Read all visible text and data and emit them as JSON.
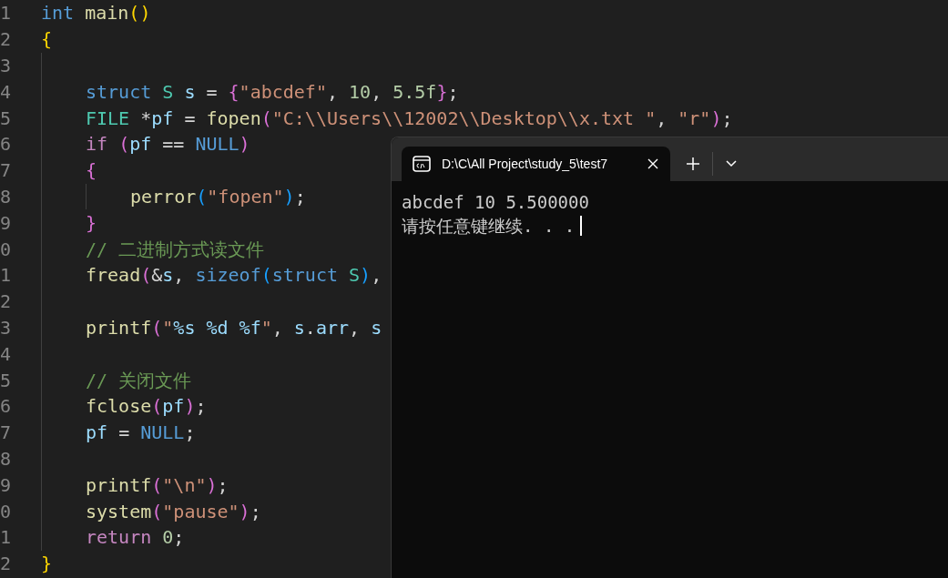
{
  "editor": {
    "lines": [
      {
        "number": "1",
        "tokens": [
          {
            "kind": "keyword",
            "text": "int "
          },
          {
            "kind": "function",
            "text": "main"
          },
          {
            "kind": "brace1",
            "text": "()"
          }
        ]
      },
      {
        "number": "2",
        "tokens": [
          {
            "kind": "brace1",
            "text": "{"
          }
        ],
        "children": [
          {
            "number": "3"
          },
          {
            "number": "4",
            "tokens": [
              {
                "kind": "keyword",
                "text": "struct "
              },
              {
                "kind": "type",
                "text": "S "
              },
              {
                "kind": "variable",
                "text": "s"
              },
              {
                "kind": "plain",
                "text": " = "
              },
              {
                "kind": "brace2",
                "text": "{"
              },
              {
                "kind": "string",
                "text": "\"abcdef\""
              },
              {
                "kind": "plain",
                "text": ", "
              },
              {
                "kind": "number",
                "text": "10"
              },
              {
                "kind": "plain",
                "text": ", "
              },
              {
                "kind": "number",
                "text": "5.5f"
              },
              {
                "kind": "brace2",
                "text": "}"
              },
              {
                "kind": "plain",
                "text": ";"
              }
            ]
          },
          {
            "number": "5",
            "tokens": [
              {
                "kind": "type",
                "text": "FILE"
              },
              {
                "kind": "plain",
                "text": " *"
              },
              {
                "kind": "variable",
                "text": "pf"
              },
              {
                "kind": "plain",
                "text": " = "
              },
              {
                "kind": "function",
                "text": "fopen"
              },
              {
                "kind": "brace2",
                "text": "("
              },
              {
                "kind": "string",
                "text": "\"C:\\\\Users\\\\12002\\\\Desktop\\\\x.txt \""
              },
              {
                "kind": "plain",
                "text": ", "
              },
              {
                "kind": "string",
                "text": "\"r\""
              },
              {
                "kind": "brace2",
                "text": ")"
              },
              {
                "kind": "plain",
                "text": ";"
              }
            ]
          },
          {
            "number": "6",
            "tokens": [
              {
                "kind": "control",
                "text": "if "
              },
              {
                "kind": "brace2",
                "text": "("
              },
              {
                "kind": "variable",
                "text": "pf"
              },
              {
                "kind": "plain",
                "text": " == "
              },
              {
                "kind": "keyword",
                "text": "NULL"
              },
              {
                "kind": "brace2",
                "text": ")"
              }
            ]
          },
          {
            "number": "7",
            "tokens": [
              {
                "kind": "brace2",
                "text": "{"
              }
            ],
            "children": [
              {
                "number": "8",
                "tokens": [
                  {
                    "kind": "function",
                    "text": "perror"
                  },
                  {
                    "kind": "brace3",
                    "text": "("
                  },
                  {
                    "kind": "string",
                    "text": "\"fopen\""
                  },
                  {
                    "kind": "brace3",
                    "text": ")"
                  },
                  {
                    "kind": "plain",
                    "text": ";"
                  }
                ]
              }
            ]
          },
          {
            "number": "9",
            "tokens": [
              {
                "kind": "brace2",
                "text": "}"
              }
            ]
          },
          {
            "number": "0",
            "tokens": [
              {
                "kind": "comment",
                "text": "// 二进制方式读文件"
              }
            ]
          },
          {
            "number": "1",
            "tokens": [
              {
                "kind": "function",
                "text": "fread"
              },
              {
                "kind": "brace2",
                "text": "("
              },
              {
                "kind": "plain",
                "text": "&"
              },
              {
                "kind": "variable",
                "text": "s"
              },
              {
                "kind": "plain",
                "text": ", "
              },
              {
                "kind": "keyword",
                "text": "sizeof"
              },
              {
                "kind": "brace3",
                "text": "("
              },
              {
                "kind": "keyword",
                "text": "struct "
              },
              {
                "kind": "type",
                "text": "S"
              },
              {
                "kind": "brace3",
                "text": ")"
              },
              {
                "kind": "plain",
                "text": ","
              }
            ]
          },
          {
            "number": "2"
          },
          {
            "number": "3",
            "tokens": [
              {
                "kind": "function",
                "text": "printf"
              },
              {
                "kind": "brace2",
                "text": "("
              },
              {
                "kind": "string",
                "text": "\""
              },
              {
                "kind": "variable",
                "text": "%s %d %f"
              },
              {
                "kind": "string",
                "text": "\""
              },
              {
                "kind": "plain",
                "text": ", "
              },
              {
                "kind": "variable",
                "text": "s"
              },
              {
                "kind": "plain",
                "text": "."
              },
              {
                "kind": "variable",
                "text": "arr"
              },
              {
                "kind": "plain",
                "text": ", "
              },
              {
                "kind": "variable",
                "text": "s"
              }
            ]
          },
          {
            "number": "4"
          },
          {
            "number": "5",
            "tokens": [
              {
                "kind": "comment",
                "text": "// 关闭文件"
              }
            ]
          },
          {
            "number": "6",
            "tokens": [
              {
                "kind": "function",
                "text": "fclose"
              },
              {
                "kind": "brace2",
                "text": "("
              },
              {
                "kind": "variable",
                "text": "pf"
              },
              {
                "kind": "brace2",
                "text": ")"
              },
              {
                "kind": "plain",
                "text": ";"
              }
            ]
          },
          {
            "number": "7",
            "tokens": [
              {
                "kind": "variable",
                "text": "pf"
              },
              {
                "kind": "plain",
                "text": " = "
              },
              {
                "kind": "keyword",
                "text": "NULL"
              },
              {
                "kind": "plain",
                "text": ";"
              }
            ]
          },
          {
            "number": "8"
          },
          {
            "number": "9",
            "tokens": [
              {
                "kind": "function",
                "text": "printf"
              },
              {
                "kind": "brace2",
                "text": "("
              },
              {
                "kind": "string",
                "text": "\"\\n\""
              },
              {
                "kind": "brace2",
                "text": ")"
              },
              {
                "kind": "plain",
                "text": ";"
              }
            ]
          },
          {
            "number": "0",
            "tokens": [
              {
                "kind": "function",
                "text": "system"
              },
              {
                "kind": "brace2",
                "text": "("
              },
              {
                "kind": "string",
                "text": "\"pause\""
              },
              {
                "kind": "brace2",
                "text": ")"
              },
              {
                "kind": "plain",
                "text": ";"
              }
            ]
          },
          {
            "number": "1",
            "tokens": [
              {
                "kind": "control",
                "text": "return "
              },
              {
                "kind": "number",
                "text": "0"
              },
              {
                "kind": "plain",
                "text": ";"
              }
            ]
          }
        ]
      },
      {
        "number": "2",
        "tokens": [
          {
            "kind": "brace1",
            "text": "}"
          }
        ]
      }
    ]
  },
  "terminal": {
    "tabs": [
      {
        "title": "D:\\C\\All Project\\study_5\\test7",
        "selected": true
      }
    ],
    "output": [
      "abcdef 10 5.500000",
      "请按任意键继续. . ."
    ]
  }
}
